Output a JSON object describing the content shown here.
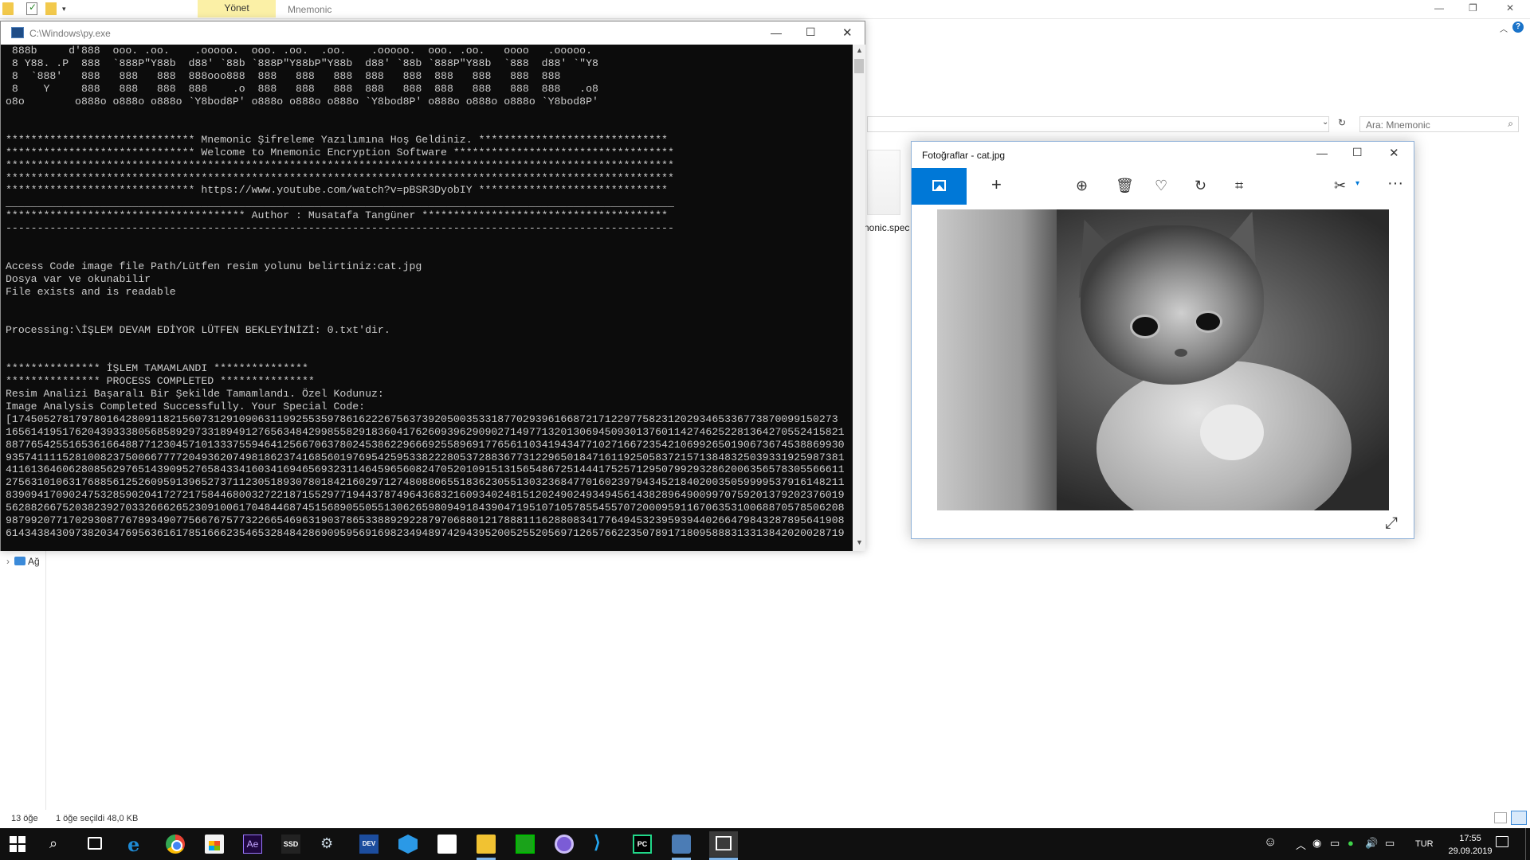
{
  "explorer": {
    "ribbon_context_tab": "Yönet",
    "window_title": "Mnemonic",
    "search_placeholder": "Ara: Mnemonic",
    "file_label": "nonic.spec",
    "nav_item": "Ağ",
    "status_count": "13 öğe",
    "status_selected": "1 öğe seçildi  48,0 KB"
  },
  "console": {
    "title": "C:\\Windows\\py.exe",
    "lines": [
      " 888b     d'888  ooo. .oo.    .ooooo.  ooo. .oo.  .oo.    .ooooo.  ooo. .oo.   oooo   .ooooo.",
      " 8 Y88. .P  888  `888P\"Y88b  d88' `88b `888P\"Y88bP\"Y88b  d88' `88b `888P\"Y88b  `888  d88' `\"Y8",
      " 8  `888'   888   888   888  888ooo888  888   888   888  888   888  888   888   888  888",
      " 8    Y     888   888   888  888    .o  888   888   888  888   888  888   888   888  888   .o8",
      "o8o        o888o o888o o888o `Y8bod8P' o888o o888o o888o `Y8bod8P' o888o o888o o888o `Y8bod8P'",
      "",
      "",
      "****************************** Mnemonic Şifreleme Yazılımına Hoş Geldiniz. ******************************",
      "****************************** Welcome to Mnemonic Encryption Software ***********************************",
      "**********************************************************************************************************",
      "**********************************************************************************************************",
      "****************************** https://www.youtube.com/watch?v=pBSR3DyobIY ******************************",
      "__________________________________________________________________________________________________________",
      "************************************** Author : Musatafa Tangüner ***************************************",
      "----------------------------------------------------------------------------------------------------------",
      "",
      "",
      "Access Code image file Path/Lütfen resim yolunu belirtiniz:cat.jpg",
      "Dosya var ve okunabilir",
      "File exists and is readable",
      "",
      "",
      "Processing:\\İŞLEM DEVAM EDİYOR LÜTFEN BEKLEYİNİZİ: 0.txt'dir.",
      "",
      "",
      "*************** İŞLEM TAMAMLANDI ***************",
      "*************** PROCESS COMPLETED ***************",
      "Resim Analizi Başaralı Bir Şekilde Tamamlandı. Özel Kodunuz:",
      "Image Analysis Completed Successfully. Your Special Code:",
      "[17450527817978016428091182156073129109063119925535978616222675637392050035331877029396166872171229775823120293465336773870099150273",
      "1656141951762043933380568589297331894912765634842998558291836041762609396290902714977132013069450930137601142746252281364270552415821",
      "8877654255165361664887712304571013337559464125667063780245386229666925589691776561103419434771027166723542106992650190673674538869930",
      "9357411115281008237500667777204936207498186237416856019769542595338222805372883677312296501847161192505837215713848325039331925987381",
      "4116136460628085629765143909527658433416034169465693231146459656082470520109151315654867251444175257129507992932862006356578305566611",
      "2756310106317688561252609591396527371123051893078018421602971274808806551836230551303236847701602397943452184020035059999537916148211",
      "8390941709024753285902041727217584468003272218715529771944378749643683216093402481512024902493494561438289649009970759201379202376019",
      "5628826675203823927033266626523091006170484468745156890550551306265980949184390471951071057855455707200095911670635310068870578506208",
      "9879920771702930877678934907756676757732266546963190378653388929228797068801217888111628808341776494532395939440266479843287895641908",
      "6143438430973820347695636161785166623546532848428690959569169823494897429439520052552056971265766223507891718095888313313842020028719"
    ]
  },
  "photos": {
    "title": "Fotoğraflar - cat.jpg"
  },
  "taskbar": {
    "language": "TUR",
    "time": "17:55",
    "date": "29.09.2019"
  }
}
